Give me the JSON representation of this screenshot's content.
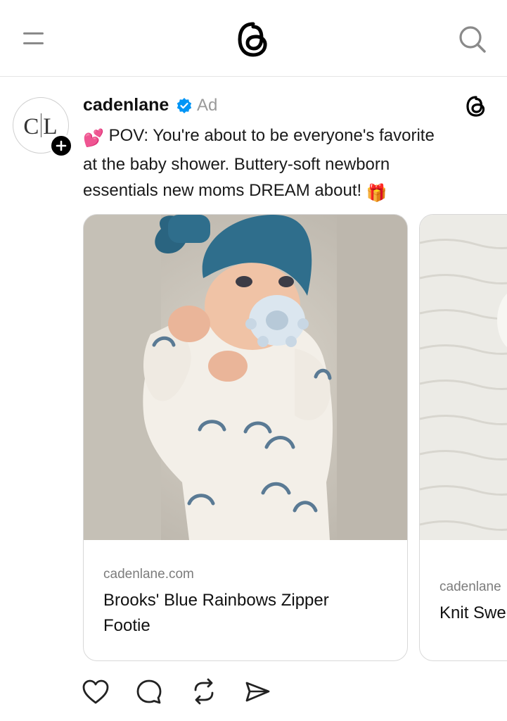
{
  "header": {
    "menu_icon": "hamburger-icon",
    "logo_icon": "threads-logo-icon",
    "search_icon": "search-icon"
  },
  "post": {
    "avatar_text_left": "C",
    "avatar_text_right": "L",
    "username": "cadenlane",
    "verified_icon": "verified-badge-icon",
    "ad_label": "Ad",
    "caption_line1": "POV: You're about to be everyone's favorite",
    "caption_line2": "at the baby shower. Buttery-soft newborn",
    "caption_line3": "essentials new moms DREAM about!",
    "caption_emoji_start": "💕",
    "caption_emoji_end": "🎁"
  },
  "carousel": {
    "cards": [
      {
        "domain": "cadenlane.com",
        "title_line1": "Brooks' Blue Rainbows Zipper",
        "title_line2": "Footie"
      },
      {
        "domain": "cadenlane",
        "title_line1": "Knit Swe"
      }
    ]
  },
  "actions": {
    "like_icon": "heart-icon",
    "reply_icon": "comment-icon",
    "repost_icon": "repost-icon",
    "share_icon": "send-icon"
  },
  "colors": {
    "accent_verified": "#0095f6",
    "hat_blue": "#2f6e8c",
    "text_muted": "#9a9a9a"
  }
}
